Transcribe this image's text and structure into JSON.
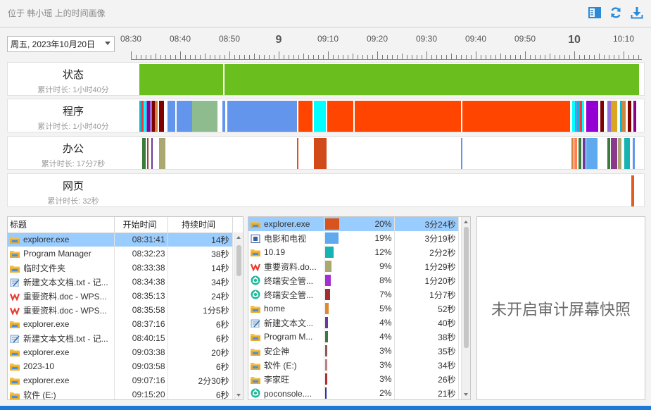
{
  "header": {
    "title": "位于 韩小瑶 上的时间画像",
    "icons": [
      "panel-icon",
      "refresh-icon",
      "download-icon"
    ],
    "accent": "#2a8ad8"
  },
  "date_select": {
    "value": "周五, 2023年10月20日"
  },
  "ruler": {
    "labels": [
      {
        "text": "08:30",
        "major": false
      },
      {
        "text": "08:40",
        "major": false
      },
      {
        "text": "08:50",
        "major": false
      },
      {
        "text": "9",
        "major": true
      },
      {
        "text": "09:10",
        "major": false
      },
      {
        "text": "09:20",
        "major": false
      },
      {
        "text": "09:30",
        "major": false
      },
      {
        "text": "09:40",
        "major": false
      },
      {
        "text": "09:50",
        "major": false
      },
      {
        "text": "10",
        "major": true
      },
      {
        "text": "10:10",
        "major": false
      }
    ]
  },
  "rows": [
    {
      "name": "状态",
      "sub": "累计时长: 1小时40分",
      "segments": [
        {
          "start": 0.0,
          "end": 0.168,
          "color": "#6abf1f"
        },
        {
          "start": 0.171,
          "end": 1.0,
          "color": "#6abf1f"
        }
      ]
    },
    {
      "name": "程序",
      "sub": "累计时长: 1小时40分",
      "segments": [
        {
          "start": 0.0,
          "end": 0.004,
          "color": "#00bcd4"
        },
        {
          "start": 0.004,
          "end": 0.008,
          "color": "#ff3333"
        },
        {
          "start": 0.008,
          "end": 0.012,
          "color": "#00ffff"
        },
        {
          "start": 0.012,
          "end": 0.016,
          "color": "#6495ed"
        },
        {
          "start": 0.016,
          "end": 0.021,
          "color": "#8b008b"
        },
        {
          "start": 0.021,
          "end": 0.026,
          "color": "#9370db"
        },
        {
          "start": 0.026,
          "end": 0.031,
          "color": "#800000"
        },
        {
          "start": 0.031,
          "end": 0.036,
          "color": "#cd853f"
        },
        {
          "start": 0.036,
          "end": 0.04,
          "color": "#ffffff"
        },
        {
          "start": 0.04,
          "end": 0.049,
          "color": "#800000"
        },
        {
          "start": 0.049,
          "end": 0.057,
          "color": "#ffffff"
        },
        {
          "start": 0.057,
          "end": 0.072,
          "color": "#6495ed"
        },
        {
          "start": 0.072,
          "end": 0.075,
          "color": "#ffffff"
        },
        {
          "start": 0.075,
          "end": 0.106,
          "color": "#6495ed"
        },
        {
          "start": 0.106,
          "end": 0.157,
          "color": "#8fbc8f"
        },
        {
          "start": 0.157,
          "end": 0.166,
          "color": "#ffffff"
        },
        {
          "start": 0.166,
          "end": 0.172,
          "color": "#6495ed"
        },
        {
          "start": 0.172,
          "end": 0.176,
          "color": "#ffffff"
        },
        {
          "start": 0.176,
          "end": 0.316,
          "color": "#6495ed"
        },
        {
          "start": 0.316,
          "end": 0.319,
          "color": "#ffffff"
        },
        {
          "start": 0.319,
          "end": 0.346,
          "color": "#ff4500"
        },
        {
          "start": 0.346,
          "end": 0.349,
          "color": "#ffffff"
        },
        {
          "start": 0.349,
          "end": 0.373,
          "color": "#00ffff"
        },
        {
          "start": 0.373,
          "end": 0.376,
          "color": "#ffffff"
        },
        {
          "start": 0.376,
          "end": 0.428,
          "color": "#ff4500"
        },
        {
          "start": 0.428,
          "end": 0.431,
          "color": "#ffffff"
        },
        {
          "start": 0.431,
          "end": 0.643,
          "color": "#ff4500"
        },
        {
          "start": 0.643,
          "end": 0.646,
          "color": "#ffffff"
        },
        {
          "start": 0.646,
          "end": 0.862,
          "color": "#ff4500"
        },
        {
          "start": 0.862,
          "end": 0.866,
          "color": "#ffffff"
        },
        {
          "start": 0.866,
          "end": 0.872,
          "color": "#00ffff"
        },
        {
          "start": 0.872,
          "end": 0.876,
          "color": "#6495ed"
        },
        {
          "start": 0.876,
          "end": 0.882,
          "color": "#00bcd4"
        },
        {
          "start": 0.882,
          "end": 0.886,
          "color": "#ff3333"
        },
        {
          "start": 0.886,
          "end": 0.89,
          "color": "#00ffff"
        },
        {
          "start": 0.89,
          "end": 0.895,
          "color": "#ffffff"
        },
        {
          "start": 0.895,
          "end": 0.918,
          "color": "#9400d3"
        },
        {
          "start": 0.918,
          "end": 0.922,
          "color": "#ffffff"
        },
        {
          "start": 0.922,
          "end": 0.929,
          "color": "#800000"
        },
        {
          "start": 0.929,
          "end": 0.936,
          "color": "#ffffff"
        },
        {
          "start": 0.936,
          "end": 0.944,
          "color": "#9370db"
        },
        {
          "start": 0.944,
          "end": 0.957,
          "color": "#daa520"
        },
        {
          "start": 0.957,
          "end": 0.962,
          "color": "#ffffff"
        },
        {
          "start": 0.962,
          "end": 0.966,
          "color": "#00bcd4"
        },
        {
          "start": 0.966,
          "end": 0.973,
          "color": "#cd853f"
        },
        {
          "start": 0.973,
          "end": 0.978,
          "color": "#ffffff"
        },
        {
          "start": 0.978,
          "end": 0.984,
          "color": "#800000"
        },
        {
          "start": 0.984,
          "end": 0.989,
          "color": "#ffffff"
        },
        {
          "start": 0.989,
          "end": 0.994,
          "color": "#8b008b"
        }
      ]
    },
    {
      "name": "办公",
      "sub": "累计时长: 17分7秒",
      "segments": [
        {
          "start": 0.005,
          "end": 0.012,
          "color": "#3a7a3a"
        },
        {
          "start": 0.015,
          "end": 0.019,
          "color": "#a04040"
        },
        {
          "start": 0.024,
          "end": 0.027,
          "color": "#6a3a9a"
        },
        {
          "start": 0.04,
          "end": 0.052,
          "color": "#aaa870"
        },
        {
          "start": 0.315,
          "end": 0.318,
          "color": "#e05020"
        },
        {
          "start": 0.349,
          "end": 0.375,
          "color": "#d04a1a"
        },
        {
          "start": 0.644,
          "end": 0.646,
          "color": "#6495ed"
        },
        {
          "start": 0.865,
          "end": 0.869,
          "color": "#cd853f"
        },
        {
          "start": 0.871,
          "end": 0.876,
          "color": "#ff7f50"
        },
        {
          "start": 0.879,
          "end": 0.884,
          "color": "#3a7a3a"
        },
        {
          "start": 0.888,
          "end": 0.893,
          "color": "#6a3a9a"
        },
        {
          "start": 0.895,
          "end": 0.917,
          "color": "#5fa9ef"
        },
        {
          "start": 0.936,
          "end": 0.942,
          "color": "#3a7a3a"
        },
        {
          "start": 0.944,
          "end": 0.956,
          "color": "#8b3a8b"
        },
        {
          "start": 0.958,
          "end": 0.965,
          "color": "#aaa870"
        },
        {
          "start": 0.971,
          "end": 0.982,
          "color": "#17b3b3"
        },
        {
          "start": 0.988,
          "end": 0.991,
          "color": "#6495ed"
        }
      ]
    },
    {
      "name": "网页",
      "sub": "累计时长: 32秒",
      "segments": [
        {
          "start": 0.985,
          "end": 0.99,
          "color": "#e85a1a"
        }
      ]
    }
  ],
  "events_table": {
    "headers": [
      "标题",
      "开始时间",
      "持续时间"
    ],
    "rows": [
      {
        "title": "explorer.exe",
        "start": "08:31:41",
        "duration": "14秒",
        "icon": "folder-icon",
        "selected": true
      },
      {
        "title": "Program Manager",
        "start": "08:32:23",
        "duration": "38秒",
        "icon": "folder-icon",
        "selected": false
      },
      {
        "title": "临时文件夹",
        "start": "08:33:38",
        "duration": "14秒",
        "icon": "folder-icon",
        "selected": false
      },
      {
        "title": "新建文本文档.txt - 记...",
        "start": "08:34:38",
        "duration": "34秒",
        "icon": "notepad-icon",
        "selected": false
      },
      {
        "title": "重要资料.doc - WPS...",
        "start": "08:35:13",
        "duration": "24秒",
        "icon": "wps-icon",
        "selected": false
      },
      {
        "title": "重要资料.doc - WPS...",
        "start": "08:35:58",
        "duration": "1分5秒",
        "icon": "wps-icon",
        "selected": false
      },
      {
        "title": "explorer.exe",
        "start": "08:37:16",
        "duration": "6秒",
        "icon": "folder-icon",
        "selected": false
      },
      {
        "title": "新建文本文档.txt - 记...",
        "start": "08:40:15",
        "duration": "6秒",
        "icon": "notepad-icon",
        "selected": false
      },
      {
        "title": "explorer.exe",
        "start": "09:03:38",
        "duration": "20秒",
        "icon": "folder-icon",
        "selected": false
      },
      {
        "title": "2023-10",
        "start": "09:03:58",
        "duration": "6秒",
        "icon": "folder-icon",
        "selected": false
      },
      {
        "title": "explorer.exe",
        "start": "09:07:16",
        "duration": "2分30秒",
        "icon": "folder-icon",
        "selected": false
      },
      {
        "title": "软件 (E:)",
        "start": "09:15:20",
        "duration": "6秒",
        "icon": "folder-icon",
        "selected": false
      }
    ]
  },
  "stats_table": {
    "rows": [
      {
        "name": "explorer.exe",
        "pct": "20%",
        "pct_value": 0.2,
        "duration": "3分24秒",
        "color": "#d9541c",
        "icon": "folder-icon",
        "selected": true
      },
      {
        "name": "电影和电视",
        "pct": "19%",
        "pct_value": 0.19,
        "duration": "3分19秒",
        "color": "#5fa9ef",
        "icon": "movie-icon",
        "selected": false
      },
      {
        "name": "10.19",
        "pct": "12%",
        "pct_value": 0.12,
        "duration": "2分2秒",
        "color": "#17b3b3",
        "icon": "folder-icon",
        "selected": false
      },
      {
        "name": "重要资料.do...",
        "pct": "9%",
        "pct_value": 0.09,
        "duration": "1分29秒",
        "color": "#aaa870",
        "icon": "wps-icon",
        "selected": false
      },
      {
        "name": "终端安全管...",
        "pct": "8%",
        "pct_value": 0.08,
        "duration": "1分20秒",
        "color": "#a42ed0",
        "icon": "security-icon",
        "selected": false
      },
      {
        "name": "终端安全管...",
        "pct": "7%",
        "pct_value": 0.07,
        "duration": "1分7秒",
        "color": "#a03030",
        "icon": "security-icon",
        "selected": false
      },
      {
        "name": "home",
        "pct": "5%",
        "pct_value": 0.05,
        "duration": "52秒",
        "color": "#e08a30",
        "icon": "folder-icon",
        "selected": false
      },
      {
        "name": "新建文本文...",
        "pct": "4%",
        "pct_value": 0.04,
        "duration": "40秒",
        "color": "#6a3a9a",
        "icon": "notepad-icon",
        "selected": false
      },
      {
        "name": "Program M...",
        "pct": "4%",
        "pct_value": 0.04,
        "duration": "38秒",
        "color": "#3a7a3a",
        "icon": "folder-icon",
        "selected": false
      },
      {
        "name": "安企神",
        "pct": "3%",
        "pct_value": 0.03,
        "duration": "35秒",
        "color": "#8b5a5a",
        "icon": "folder-icon",
        "selected": false
      },
      {
        "name": "软件 (E:)",
        "pct": "3%",
        "pct_value": 0.03,
        "duration": "34秒",
        "color": "#c08080",
        "icon": "folder-icon",
        "selected": false
      },
      {
        "name": "李家旺",
        "pct": "3%",
        "pct_value": 0.03,
        "duration": "26秒",
        "color": "#b03030",
        "icon": "folder-icon",
        "selected": false
      },
      {
        "name": "poconsole....",
        "pct": "2%",
        "pct_value": 0.02,
        "duration": "21秒",
        "color": "#3030a0",
        "icon": "security-icon",
        "selected": false
      }
    ]
  },
  "snapshot": {
    "text": "未开启审计屏幕快照"
  }
}
